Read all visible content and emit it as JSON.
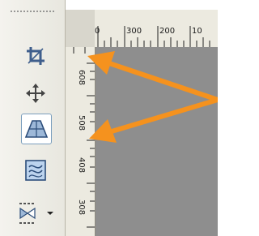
{
  "toolbar": {
    "tools": [
      {
        "name": "crop-tool",
        "icon": "crop-icon"
      },
      {
        "name": "move-tool",
        "icon": "move-arrows-icon"
      },
      {
        "name": "perspective-tool",
        "icon": "perspective-icon",
        "active": true
      },
      {
        "name": "distort-tool",
        "icon": "distort-icon"
      },
      {
        "name": "flip-tool",
        "icon": "flip-icon",
        "has_dropdown": true
      }
    ]
  },
  "ruler": {
    "top_labels": [
      "0",
      "300",
      "200",
      "10"
    ],
    "left_labels": [
      "608",
      "508",
      "408",
      "308"
    ]
  },
  "colors": {
    "canvas": "#8e8e8e",
    "annotation_arrow": "#f5921e",
    "active_tool_border": "#7b9ebd"
  }
}
